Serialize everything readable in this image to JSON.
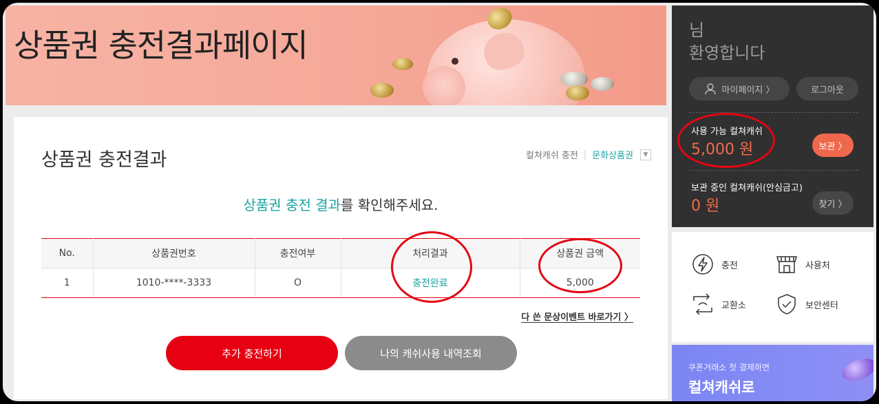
{
  "banner": {
    "title": "상품권 충전결과페이지"
  },
  "main": {
    "section_title": "상품권 충전결과",
    "crumbs": {
      "item1": "컬쳐캐쉬 충전",
      "item2": "문화상품권",
      "dropdown": "▼"
    },
    "notice": {
      "highlight": "상품권 충전 결과",
      "rest": "를 확인해주세요."
    },
    "table": {
      "headers": [
        "No.",
        "상품권번호",
        "충전여부",
        "처리결과",
        "상품권 금액"
      ],
      "rows": [
        [
          "1",
          "1010-****-3333",
          "O",
          "충전완료",
          "5,000"
        ]
      ]
    },
    "event_link": "다 쓴 문상이벤트 바로가기 〉",
    "buttons": {
      "charge_more": "추가 충전하기",
      "history": "나의 캐쉬사용 내역조회"
    }
  },
  "sidebar": {
    "greeting_line1": "님",
    "greeting_line2": "환영합니다",
    "mypage": "마이페이지 〉",
    "logout": "로그아웃",
    "available_label": "사용 가능 컬쳐캐쉬",
    "available_value": "5,000 원",
    "keep_button": "보관 〉",
    "stored_label": "보관 중인 컬쳐캐쉬(안심금고)",
    "stored_value": "0 원",
    "find_button": "찾기 〉",
    "menu": [
      {
        "label": "충전",
        "icon": "charge-bolt-icon"
      },
      {
        "label": "사용처",
        "icon": "store-icon"
      },
      {
        "label": "교환소",
        "icon": "exchange-icon"
      },
      {
        "label": "보안센터",
        "icon": "shield-check-icon"
      }
    ],
    "promo": {
      "sub": "쿠폰거래소 첫 결제하면",
      "main": "컬쳐캐쉬로"
    }
  },
  "colors": {
    "accent_red": "#e60012",
    "teal": "#1aa3a3",
    "orange": "#f0684c",
    "annotation": "#e30613"
  }
}
